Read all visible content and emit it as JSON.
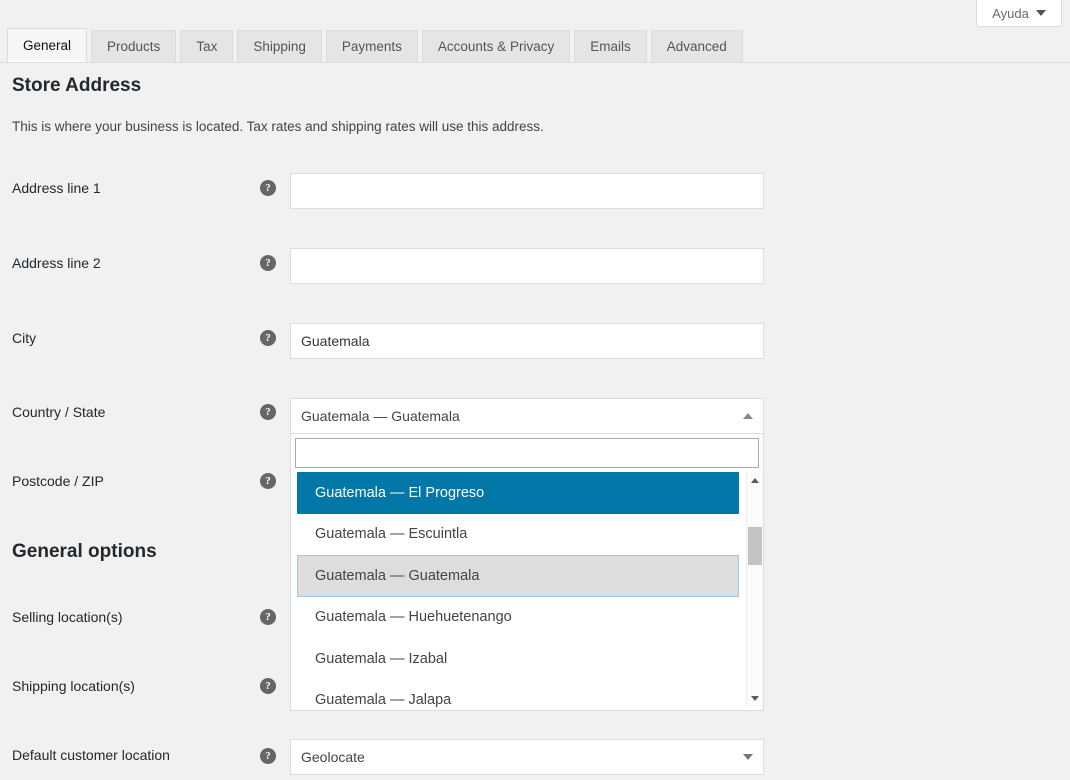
{
  "help_button": {
    "label": "Ayuda",
    "icon": "caret-down-icon"
  },
  "tabs": [
    {
      "label": "General",
      "active": true
    },
    {
      "label": "Products",
      "active": false
    },
    {
      "label": "Tax",
      "active": false
    },
    {
      "label": "Shipping",
      "active": false
    },
    {
      "label": "Payments",
      "active": false
    },
    {
      "label": "Accounts & Privacy",
      "active": false
    },
    {
      "label": "Emails",
      "active": false
    },
    {
      "label": "Advanced",
      "active": false
    }
  ],
  "store_address": {
    "title": "Store Address",
    "description": "This is where your business is located. Tax rates and shipping rates will use this address.",
    "fields": [
      {
        "label": "Address line 1",
        "value": "",
        "placeholder": ""
      },
      {
        "label": "Address line 2",
        "value": "",
        "placeholder": ""
      },
      {
        "label": "City",
        "value": "Guatemala",
        "placeholder": ""
      },
      {
        "label": "Country / State",
        "value": "Guatemala — Guatemala"
      },
      {
        "label": "Postcode / ZIP",
        "value": "",
        "placeholder": ""
      }
    ]
  },
  "country_dropdown": {
    "selected_text": "Guatemala — Guatemala",
    "search_value": "",
    "search_placeholder": "",
    "toggle_icon": "caret-up-icon",
    "options": [
      {
        "label": "Guatemala — El Progreso",
        "state": "highlighted"
      },
      {
        "label": "Guatemala — Escuintla",
        "state": "normal"
      },
      {
        "label": "Guatemala — Guatemala",
        "state": "selected"
      },
      {
        "label": "Guatemala — Huehuetenango",
        "state": "normal"
      },
      {
        "label": "Guatemala — Izabal",
        "state": "normal"
      },
      {
        "label": "Guatemala — Jalapa",
        "state": "normal"
      }
    ],
    "highlight_color": "#0277a8",
    "selected_bg_color": "#dddddd"
  },
  "general_options": {
    "title": "General options",
    "rows": [
      {
        "label": "Selling location(s)"
      },
      {
        "label": "Shipping location(s)"
      },
      {
        "label": "Default customer location",
        "value": "Geolocate"
      }
    ]
  },
  "colors": {
    "page_background": "#f1f1f1",
    "accent": "#0277a8",
    "text": "#23282d"
  }
}
